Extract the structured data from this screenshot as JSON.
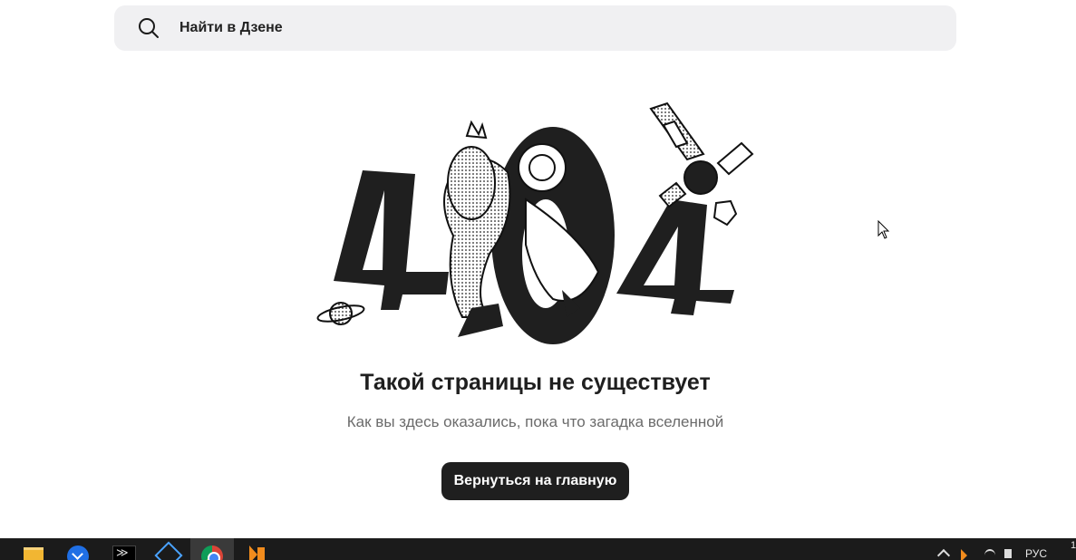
{
  "search": {
    "placeholder": "Найти в Дзене"
  },
  "hero": {
    "illustration": "404-astronaut-illustration"
  },
  "error": {
    "title": "Такой страницы не существует",
    "subtitle": "Как вы здесь оказались, пока что загадка вселенной",
    "home_button": "Вернуться на главную"
  },
  "taskbar": {
    "apps": [
      "file-explorer-icon",
      "mail-icon",
      "terminal-icon",
      "network-app-icon",
      "chrome-icon",
      "orange-app-icon"
    ],
    "active_app": "chrome-icon",
    "tray": {
      "language": "РУС",
      "clock_fragment": "1"
    }
  },
  "colors": {
    "search_bg": "#f0f0f2",
    "button_bg": "#1f1f1f",
    "subtitle": "#6b6b6b",
    "taskbar_bg": "#1b1b1b"
  }
}
